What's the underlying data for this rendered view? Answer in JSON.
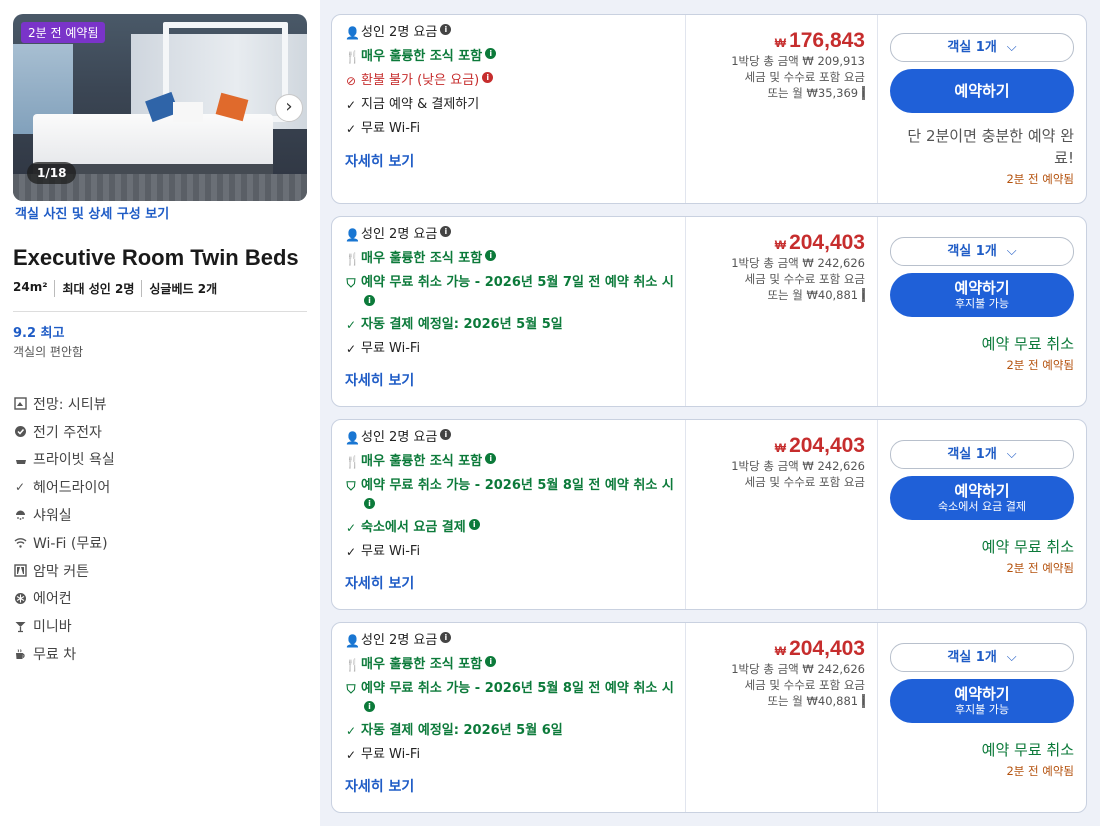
{
  "room": {
    "badge": "2분 전 예약됨",
    "photo_counter": "1/18",
    "photo_link": "객실 사진 및 상세 구성 보기",
    "title": "Executive Room Twin Beds",
    "size": "24m²",
    "max_guests": "최대 성인 2명",
    "beds": "싱글베드 2개",
    "rating_score": "9.2 최고",
    "rating_label": "객실의 편안함",
    "amenities": [
      {
        "icon": "view-icon",
        "label": "전망: 시티뷰"
      },
      {
        "icon": "ev-charger-icon",
        "label": "전기 주전자"
      },
      {
        "icon": "bathtub-icon",
        "label": "프라이빗 욕실"
      },
      {
        "icon": "check-icon",
        "label": "헤어드라이어"
      },
      {
        "icon": "shower-icon",
        "label": "샤워실"
      },
      {
        "icon": "wifi-icon",
        "label": "Wi-Fi (무료)"
      },
      {
        "icon": "curtain-icon",
        "label": "암막 커튼"
      },
      {
        "icon": "snowflake-icon",
        "label": "에어컨"
      },
      {
        "icon": "cocktail-icon",
        "label": "미니바"
      },
      {
        "icon": "tea-icon",
        "label": "무료 차"
      }
    ]
  },
  "offers": [
    {
      "guests": "성인 2명 요금",
      "breakfast": "매우 훌륭한 조식 포함",
      "cancel": "환불 불가 (낮은 요금)",
      "extra": "지금 예약 & 결제하기",
      "wifi": "무료 Wi-Fi",
      "detail": "자세히 보기",
      "currency": "₩",
      "price": "176,843",
      "total": "1박당 총 금액 ₩ 209,913",
      "tax": "세금 및 수수료 포함 요금",
      "monthly": "또는 월 ₩35,369",
      "qty": "객실 1개",
      "book": "예약하기",
      "book_sub": "",
      "note": "단 2분이면 충분한 예약 완료!",
      "recent": "2분 전 예약됨"
    },
    {
      "guests": "성인 2명 요금",
      "breakfast": "매우 훌륭한 조식 포함",
      "cancel": "예약 무료 취소 가능 - 2026년 5월 7일 전 예약 취소 시",
      "extra": "자동 결제 예정일: 2026년 5월 5일",
      "wifi": "무료 Wi-Fi",
      "detail": "자세히 보기",
      "currency": "₩",
      "price": "204,403",
      "total": "1박당 총 금액 ₩ 242,626",
      "tax": "세금 및 수수료 포함 요금",
      "monthly": "또는 월 ₩40,881",
      "qty": "객실 1개",
      "book": "예약하기",
      "book_sub": "후지불 가능",
      "note": "예약 무료 취소",
      "recent": "2분 전 예약됨"
    },
    {
      "guests": "성인 2명 요금",
      "breakfast": "매우 훌륭한 조식 포함",
      "cancel": "예약 무료 취소 가능 - 2026년 5월 8일 전 예약 취소 시",
      "extra": "숙소에서 요금 결제",
      "wifi": "무료 Wi-Fi",
      "detail": "자세히 보기",
      "currency": "₩",
      "price": "204,403",
      "total": "1박당 총 금액 ₩ 242,626",
      "tax": "세금 및 수수료 포함 요금",
      "monthly": "",
      "qty": "객실 1개",
      "book": "예약하기",
      "book_sub": "숙소에서 요금 결제",
      "note": "예약 무료 취소",
      "recent": "2분 전 예약됨"
    },
    {
      "guests": "성인 2명 요금",
      "breakfast": "매우 훌륭한 조식 포함",
      "cancel": "예약 무료 취소 가능 - 2026년 5월 8일 전 예약 취소 시",
      "extra": "자동 결제 예정일: 2026년 5월 6일",
      "wifi": "무료 Wi-Fi",
      "detail": "자세히 보기",
      "currency": "₩",
      "price": "204,403",
      "total": "1박당 총 금액 ₩ 242,626",
      "tax": "세금 및 수수료 포함 요금",
      "monthly": "또는 월 ₩40,881",
      "qty": "객실 1개",
      "book": "예약하기",
      "book_sub": "후지불 가능",
      "note": "예약 무료 취소",
      "recent": "2분 전 예약됨"
    }
  ],
  "colors": {
    "price": "#c62d2d",
    "accent": "#1f60d8",
    "success": "#0c7a3a",
    "recent": "#b4520e"
  }
}
